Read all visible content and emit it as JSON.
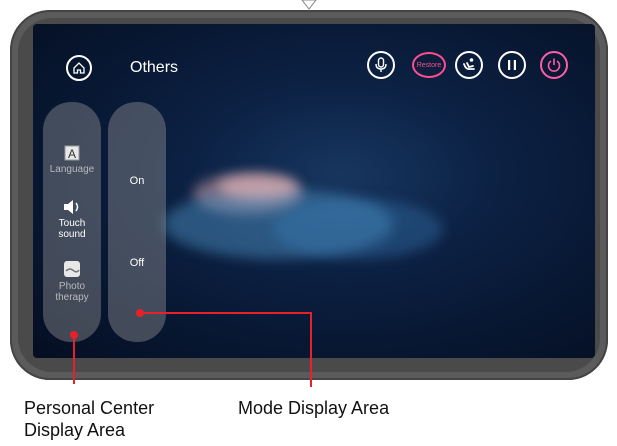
{
  "header": {
    "title": "Others",
    "home_icon": "home-icon",
    "icons": [
      "microphone-icon",
      "restore-button",
      "massage-chair-icon",
      "pause-icon",
      "power-icon"
    ],
    "restore_label": "Restore"
  },
  "personal_panel": {
    "items": [
      {
        "label": "Language",
        "icon": "language-icon"
      },
      {
        "label": "Touch\nsound",
        "icon": "speaker-icon"
      },
      {
        "label": "Photo\ntherapy",
        "icon": "photo-therapy-icon"
      }
    ]
  },
  "mode_panel": {
    "options": [
      "On",
      "Off"
    ]
  },
  "annotations": {
    "personal_center": "Personal Center\nDisplay Area",
    "mode_display": "Mode Display Area"
  },
  "colors": {
    "accent_pink": "#ff4d8d",
    "annotation_red": "#e8202a",
    "frame": "#5b5b5b"
  }
}
